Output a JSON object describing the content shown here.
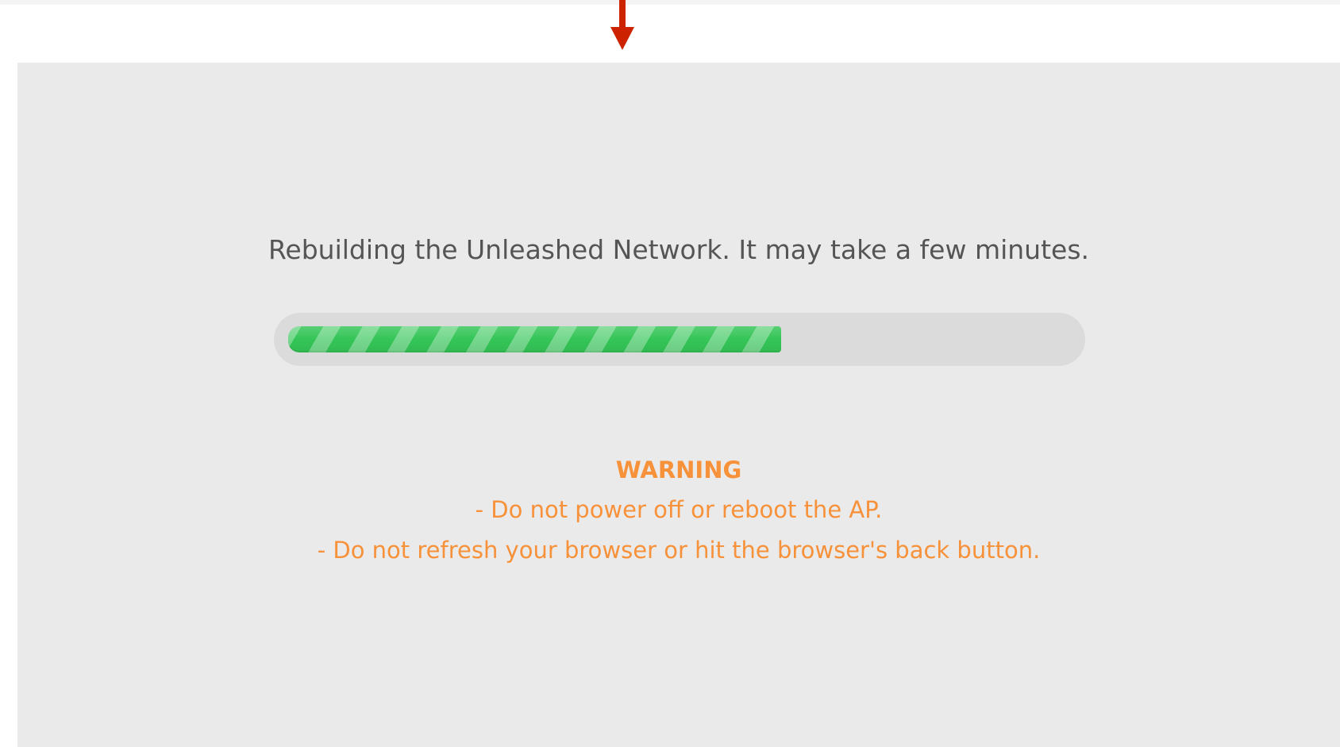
{
  "status": {
    "message": "Rebuilding the Unleashed Network. It may take a few minutes."
  },
  "progress": {
    "fraction": 0.63,
    "fill_color": "#34c557",
    "track_color": "#dbdbdb"
  },
  "warning": {
    "title": "WARNING",
    "lines": [
      "- Do not power off or reboot the AP.",
      "- Do not refresh your browser or hit the browser's back button."
    ],
    "color": "#f7913a"
  },
  "annotation": {
    "icon": "down-arrow-icon",
    "color": "#cc2200"
  },
  "colors": {
    "panel_background": "#eaeaea",
    "message_text": "#555555"
  }
}
